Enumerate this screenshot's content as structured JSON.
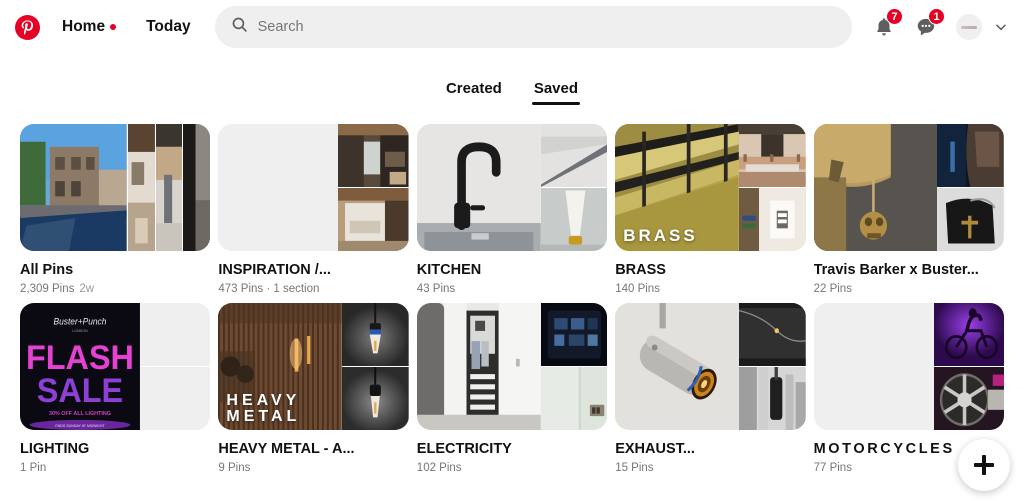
{
  "header": {
    "logo_icon": "pinterest-logo-icon",
    "nav": [
      {
        "label": "Home",
        "has_dot": true
      },
      {
        "label": "Today",
        "has_dot": false
      }
    ],
    "search": {
      "placeholder": "Search",
      "value": "",
      "icon": "search-icon"
    },
    "notifications": {
      "icon": "bell-icon",
      "badge": "7"
    },
    "messages": {
      "icon": "chat-bubble-icon",
      "badge": "1"
    },
    "avatar_icon": "avatar-icon",
    "account_chevron_icon": "chevron-down-icon",
    "accent_color": "#e60023"
  },
  "tabs": [
    {
      "label": "Created",
      "active": false
    },
    {
      "label": "Saved",
      "active": true
    }
  ],
  "boards": [
    {
      "title": "All Pins",
      "pins": "2,309 Pins",
      "age": "2w",
      "meta": "2,309 Pins",
      "layout": "main-plus-strips",
      "overlay": ""
    },
    {
      "title": "INSPIRATION /...",
      "pins": "473 Pins",
      "age": "",
      "meta": "473 Pins · 1 section",
      "layout": "empty-plus-stack",
      "overlay": ""
    },
    {
      "title": "KITCHEN",
      "pins": "43 Pins",
      "age": "",
      "meta": "43 Pins",
      "layout": "main-plus-stack",
      "overlay": ""
    },
    {
      "title": "BRASS",
      "pins": "140 Pins",
      "age": "",
      "meta": "140 Pins",
      "layout": "main-plus-stack",
      "overlay": "BRASS"
    },
    {
      "title": "Travis Barker x Buster...",
      "pins": "22 Pins",
      "age": "",
      "meta": "22 Pins",
      "layout": "main-plus-stack",
      "overlay": ""
    },
    {
      "title": "LIGHTING",
      "pins": "1 Pin",
      "age": "",
      "meta": "1 Pin",
      "layout": "main-plus-empty-stack",
      "overlay": ""
    },
    {
      "title": "HEAVY METAL - A...",
      "pins": "9 Pins",
      "age": "",
      "meta": "9 Pins",
      "layout": "main-plus-stack",
      "overlay": "HEAVY\nMETAL"
    },
    {
      "title": "ELECTRICITY",
      "pins": "102 Pins",
      "age": "",
      "meta": "102 Pins",
      "layout": "main-plus-stack",
      "overlay": ""
    },
    {
      "title": "EXHAUST...",
      "pins": "15 Pins",
      "age": "",
      "meta": "15 Pins",
      "layout": "main-plus-stack",
      "overlay": ""
    },
    {
      "title": "MOTORCYCLES",
      "pins": "77 Pins",
      "age": "",
      "meta": "77 Pins",
      "layout": "empty-plus-stack",
      "overlay": ""
    }
  ],
  "fab": {
    "icon": "plus-icon",
    "label": "Create"
  }
}
